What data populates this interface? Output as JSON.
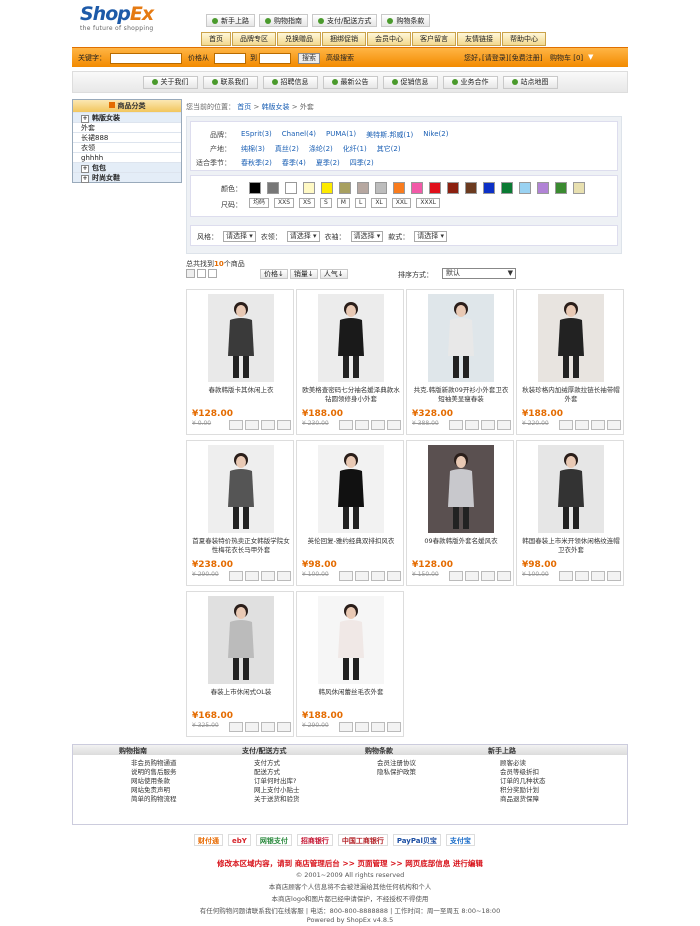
{
  "logo": {
    "text_a": "Shop",
    "text_b": "Ex",
    "slogan": "the future of shopping"
  },
  "toplinks": [
    "新手上路",
    "购物指南",
    "支付/配送方式",
    "购物条款"
  ],
  "mainnav": [
    "首页",
    "品牌专区",
    "兑换赠品",
    "捆绑促销",
    "会员中心",
    "客户留言",
    "友情链接",
    "帮助中心"
  ],
  "search": {
    "keyword_label": "关键字：",
    "price_label": "价格从",
    "to_label": "到",
    "search_btn": "搜索",
    "advanced": "高级搜索",
    "welcome": "您好，",
    "login": "[请登录]",
    "register": "[免费注册]",
    "cart": "购物车 [0]"
  },
  "subnav": [
    "关于我们",
    "联系我们",
    "招聘信息",
    "最新公告",
    "促销信息",
    "业务合作",
    "站点地图"
  ],
  "sidebar": {
    "title": "商品分类",
    "items": [
      {
        "label": "韩版女装",
        "group": true
      },
      {
        "label": "外套",
        "group": false
      },
      {
        "label": "长裙888",
        "group": false
      },
      {
        "label": "衣领",
        "group": false
      },
      {
        "label": "ghhhh",
        "group": false
      },
      {
        "label": "包包",
        "group": true
      },
      {
        "label": "时尚女鞋",
        "group": true
      }
    ]
  },
  "breadcrumb": {
    "prefix": "您当前的位置：",
    "home": "首页",
    "cat": "韩版女装",
    "current": "外套"
  },
  "filters": {
    "brand_label": "品牌：",
    "brands": [
      "ESprit(3)",
      "Chanel(4)",
      "PUMA(1)",
      "美特斯.邦威(1)",
      "Nike(2)"
    ],
    "origin_label": "产地：",
    "origins": [
      "纯棉(3)",
      "真丝(2)",
      "涤纶(2)",
      "化纤(1)",
      "其它(2)"
    ],
    "season_label": "适合季节：",
    "seasons": [
      "春秋季(2)",
      "春季(4)",
      "夏季(2)",
      "四季(2)"
    ],
    "color_label": "颜色：",
    "colors": [
      "#000000",
      "#777777",
      "#ffffff",
      "#fff9c4",
      "#fdea00",
      "#a8a060",
      "#b6a7a0",
      "#bdbdbd",
      "#f97c1e",
      "#f25aa8",
      "#e0101b",
      "#8b1f0f",
      "#6b3a1f",
      "#0c30c6",
      "#0a7a33",
      "#9ad2f2",
      "#b183d6",
      "#3a8a30",
      "#e8e0b0"
    ],
    "size_label": "尺码：",
    "sizes": [
      "均码",
      "XXS",
      "XS",
      "S",
      "M",
      "L",
      "XL",
      "XXL",
      "XXXL"
    ],
    "selects": [
      {
        "label": "风格：",
        "value": "请选择"
      },
      {
        "label": "衣领：",
        "value": "请选择"
      },
      {
        "label": "衣袖：",
        "value": "请选择"
      },
      {
        "label": "款式：",
        "value": "请选择"
      }
    ]
  },
  "count": {
    "pre": "总共找到",
    "num": "10",
    "post": "个商品"
  },
  "sort": {
    "tabs": [
      "价格",
      "销量",
      "人气"
    ],
    "label": "排序方式：",
    "value": "默认"
  },
  "products": [
    {
      "name": "春款韩版卡其休闲上衣",
      "price": "¥128.00",
      "mprice": "¥ 0.00",
      "tone": "#3a3a3a",
      "bg": "#e9e9e9"
    },
    {
      "name": "欧美格查密码七分袖名媛泽典款水钻圆领修身小外套",
      "price": "¥188.00",
      "mprice": "¥ 230.00",
      "tone": "#1a1a1a",
      "bg": "#ececec"
    },
    {
      "name": "共克.韩版新款09开衫小外套卫衣短袖美显瘦春装",
      "price": "¥328.00",
      "mprice": "¥ 388.00",
      "tone": "#e8e8e8",
      "bg": "#dfe6ea"
    },
    {
      "name": "秋装珍格内加绒厚款拉链长袖带帽外套",
      "price": "¥188.00",
      "mprice": "¥ 220.00",
      "tone": "#222",
      "bg": "#e8e4e0"
    },
    {
      "name": "首夏春装特价热卖正女韩版学院女性梅花衣长马甲外套",
      "price": "¥238.00",
      "mprice": "¥ 290.00",
      "tone": "#555",
      "bg": "#eeeeee"
    },
    {
      "name": "英伦回复-雅约经典双排扣风衣",
      "price": "¥98.00",
      "mprice": "¥ 100.00",
      "tone": "#111",
      "bg": "#f2f2f2"
    },
    {
      "name": "09春款韩版外套名媛风衣",
      "price": "¥128.00",
      "mprice": "¥ 150.00",
      "tone": "#c8c8cc",
      "bg": "#5a5050"
    },
    {
      "name": "韩国春装上市米开领休闲格纹连帽卫衣外套",
      "price": "¥98.00",
      "mprice": "¥ 100.00",
      "tone": "#333",
      "bg": "#e6e6e6"
    },
    {
      "name": "春装上市休闲式OL装",
      "price": "¥168.00",
      "mprice": "¥ 325.00",
      "tone": "#bbb",
      "bg": "#e0e0e0"
    },
    {
      "name": "韩风休闲蕾丝毛衣外套",
      "price": "¥188.00",
      "mprice": "¥ 290.00",
      "tone": "#f0e8e6",
      "bg": "#f6f6f6"
    }
  ],
  "footer": {
    "cols": [
      {
        "title": "购物指南",
        "links": [
          "非会员购物通道",
          "说明的售后服务",
          "网站使用条款",
          "网站免责声明",
          "简单的购物流程"
        ]
      },
      {
        "title": "支付/配送方式",
        "links": [
          "支付方式",
          "配送方式",
          "订单何时出库?",
          "网上支付小贴士",
          "关于送货和验货"
        ]
      },
      {
        "title": "购物条款",
        "links": [
          "会员注册协议",
          "隐私保护政策"
        ]
      },
      {
        "title": "新手上路",
        "links": [
          "顾客必读",
          "会员等级折扣",
          "订单的几种状态",
          "积分奖励计划",
          "商品退货保障"
        ]
      }
    ]
  },
  "payments": [
    "财付通",
    "ebY",
    "网银支付",
    "招商银行",
    "中国工商银行",
    "PayPal贝宝",
    "支付宝"
  ],
  "bottom": {
    "edit": "修改本区域内容，请到 商店管理后台 >> 页面管理 >> 网页底部信息 进行编辑",
    "copy": "© 2001~2009 All rights reserved",
    "l1": "本商店顾客个人信息将不会被泄漏给其他任何机构和个人",
    "l2": "本商店logo和图片都已经申请保护，不经授权不得使用",
    "l3": "有任何购物问题请联系我们在线客服 | 电话：800-800-8888888 | 工作时间：周一至周五 8:00~18:00",
    "powered": "Powered by ShopEx v4.8.5"
  }
}
